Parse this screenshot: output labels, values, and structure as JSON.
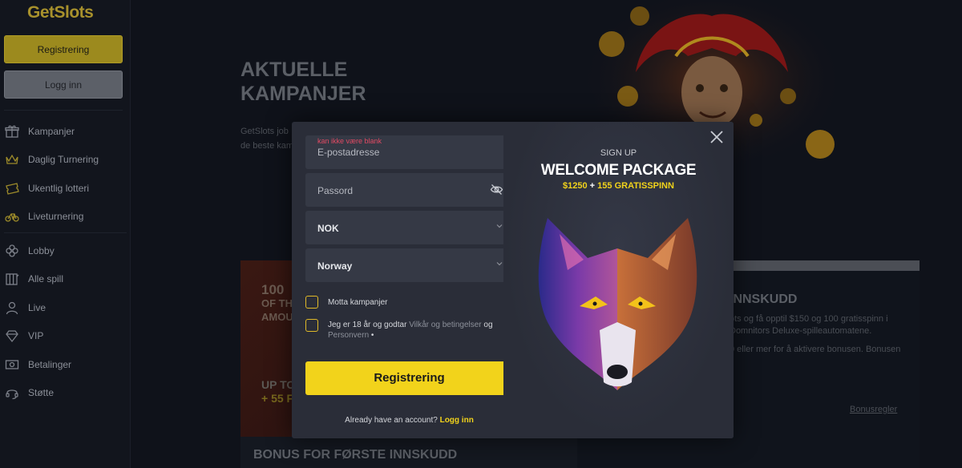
{
  "brand": {
    "name": "GetSlots",
    "color_get": "#a8912c",
    "color_slots": "#8c7a2c"
  },
  "sidebar": {
    "register_label": "Registrering",
    "login_label": "Logg inn",
    "items": [
      {
        "label": "Kampanjer",
        "icon": "gift-icon"
      },
      {
        "label": "Daglig Turnering",
        "icon": "crown-icon"
      },
      {
        "label": "Ukentlig lotteri",
        "icon": "ticket-icon"
      },
      {
        "label": "Liveturnering",
        "icon": "bicycle-icon"
      },
      {
        "label": "Lobby",
        "icon": "clover-icon"
      },
      {
        "label": "Alle spill",
        "icon": "slot-machine-icon"
      },
      {
        "label": "Live",
        "icon": "person-icon"
      },
      {
        "label": "VIP",
        "icon": "diamond-icon"
      },
      {
        "label": "Betalinger",
        "icon": "money-icon"
      },
      {
        "label": "Støtte",
        "icon": "headset-icon"
      }
    ]
  },
  "main": {
    "hero_title_line1": "AKTUELLE",
    "hero_title_line2": "KAMPANJER",
    "hero_text_line1": "GetSlots job",
    "hero_text_line2": "de beste kam",
    "card_left_line1": "100",
    "card_left_line2": "OF TH",
    "card_left_line3": "AMOU",
    "card_left_bottom1": "UP TO",
    "card_left_bottom2": "+ 55 F",
    "card_right_title": "INNSKUDD",
    "card_right_text1": "ots og få opptil $150 og 100 gratisspinn i",
    "card_right_text2": " Domnitors Deluxe-spilleautomatene.",
    "card_right_text3": "0 eller mer for å aktivere bonusen. Bonusen",
    "card_right_link": "Bonusregler",
    "bonus_bar": "BONUS FOR FØRSTE INNSKUDD"
  },
  "modal": {
    "email_error": "kan ikke være blank",
    "email_placeholder": "E-postadresse",
    "password_placeholder": "Passord",
    "currency_value": "NOK",
    "country_value": "Norway",
    "checkbox1_label": "Motta kampanjer",
    "checkbox2_prefix": "Jeg er 18 år og godtar ",
    "checkbox2_link1": "Vilkår og betingelser",
    "checkbox2_og": " og",
    "checkbox2_link2": "Personvern",
    "checkbox2_dot": " •",
    "submit_label": "Registrering",
    "already_text": "Already have an account? ",
    "already_link": "Logg inn",
    "close_symbol": "✕",
    "promo_sign": "SIGN UP",
    "promo_head": "WELCOME PACKAGE",
    "promo_amount": "$1250",
    "promo_plus": " + ",
    "promo_spins": "155 GRATISSPINN",
    "accent": "#f2d31b",
    "error_color": "#e24a63"
  }
}
